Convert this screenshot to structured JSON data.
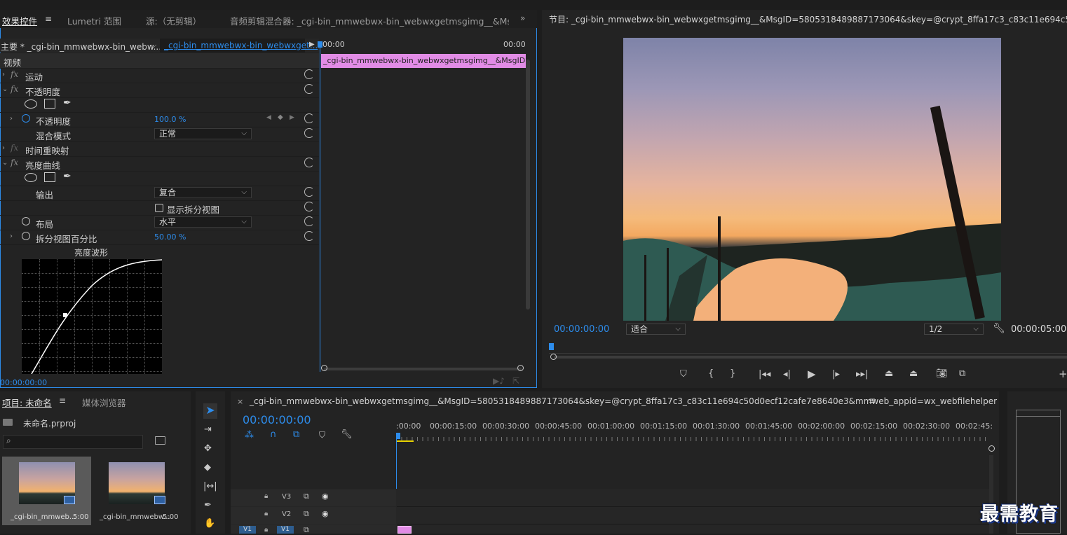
{
  "effects_panel": {
    "tabs": [
      "效果控件",
      "Lumetri 范围",
      "源:（无剪辑）",
      "音频剪辑混合器: _cgi-bin_mmwebwx-bin_webwxgetmsgimg__&MsgID=5805"
    ],
    "master_clip": "主要 * _cgi-bin_mmwebwx-bin_webw...",
    "sequence_clip": "_cgi-bin_mmwebwx-bin_webwxget...",
    "mini_tc_start": "00:00",
    "mini_tc_end": "00:00",
    "mini_clip_label": "_cgi-bin_mmwebwx-bin_webwxgetmsgimg__&MsgID=58",
    "section_video": "视频",
    "motion": "运动",
    "opacity_group": "不透明度",
    "opacity_param": "不透明度",
    "opacity_value": "100.0 %",
    "blend_mode_label": "混合模式",
    "blend_mode_value": "正常",
    "time_remap": "时间重映射",
    "luma_curves": "亮度曲线",
    "output_label": "输出",
    "output_value": "复合",
    "show_split": "显示拆分视图",
    "layout_label": "布局",
    "layout_value": "水平",
    "split_percent_label": "拆分视图百分比",
    "split_percent_value": "50.00 %",
    "waveform_title": "亮度波形",
    "bottom_tc": "00:00:00:00"
  },
  "program_monitor": {
    "title": "节目: _cgi-bin_mmwebwx-bin_webwxgetmsgimg__&MsgID=5805318489887173064&skey=@crypt_8ffa17c3_c83c11e694c50d0ecf12cafe7e8640e3&",
    "timecode": "00:00:00:00",
    "fit": "适合",
    "resolution": "1/2",
    "duration": "00:00:05:00"
  },
  "project_panel": {
    "tab_project": "项目: 未命名",
    "tab_media": "媒体浏览器",
    "file": "未命名.prproj",
    "clips": [
      {
        "name": "_cgi-bin_mmweb...",
        "duration": "5:00"
      },
      {
        "name": "_cgi-bin_mmwebw...",
        "duration": "5:00"
      }
    ]
  },
  "timeline": {
    "title": "_cgi-bin_mmwebwx-bin_webwxgetmsgimg__&MsgID=5805318489887173064&skey=@crypt_8ffa17c3_c83c11e694c50d0ecf12cafe7e8640e3&mmweb_appid=wx_webfilehelper",
    "timecode": "00:00:00:00",
    "ruler": [
      ":00:00",
      "00:00:15:00",
      "00:00:30:00",
      "00:00:45:00",
      "00:01:00:00",
      "00:01:15:00",
      "00:01:30:00",
      "00:01:45:00",
      "00:02:00:00",
      "00:02:15:00",
      "00:02:30:00",
      "00:02:45:"
    ],
    "tracks": [
      "V3",
      "V2",
      "V1"
    ],
    "src_patch": "V1"
  },
  "watermark": "最需教育",
  "colors": {
    "accent_blue": "#2d8ceb",
    "clip_pink": "#e28ce6",
    "playhead_yellow": "#e8d300"
  }
}
